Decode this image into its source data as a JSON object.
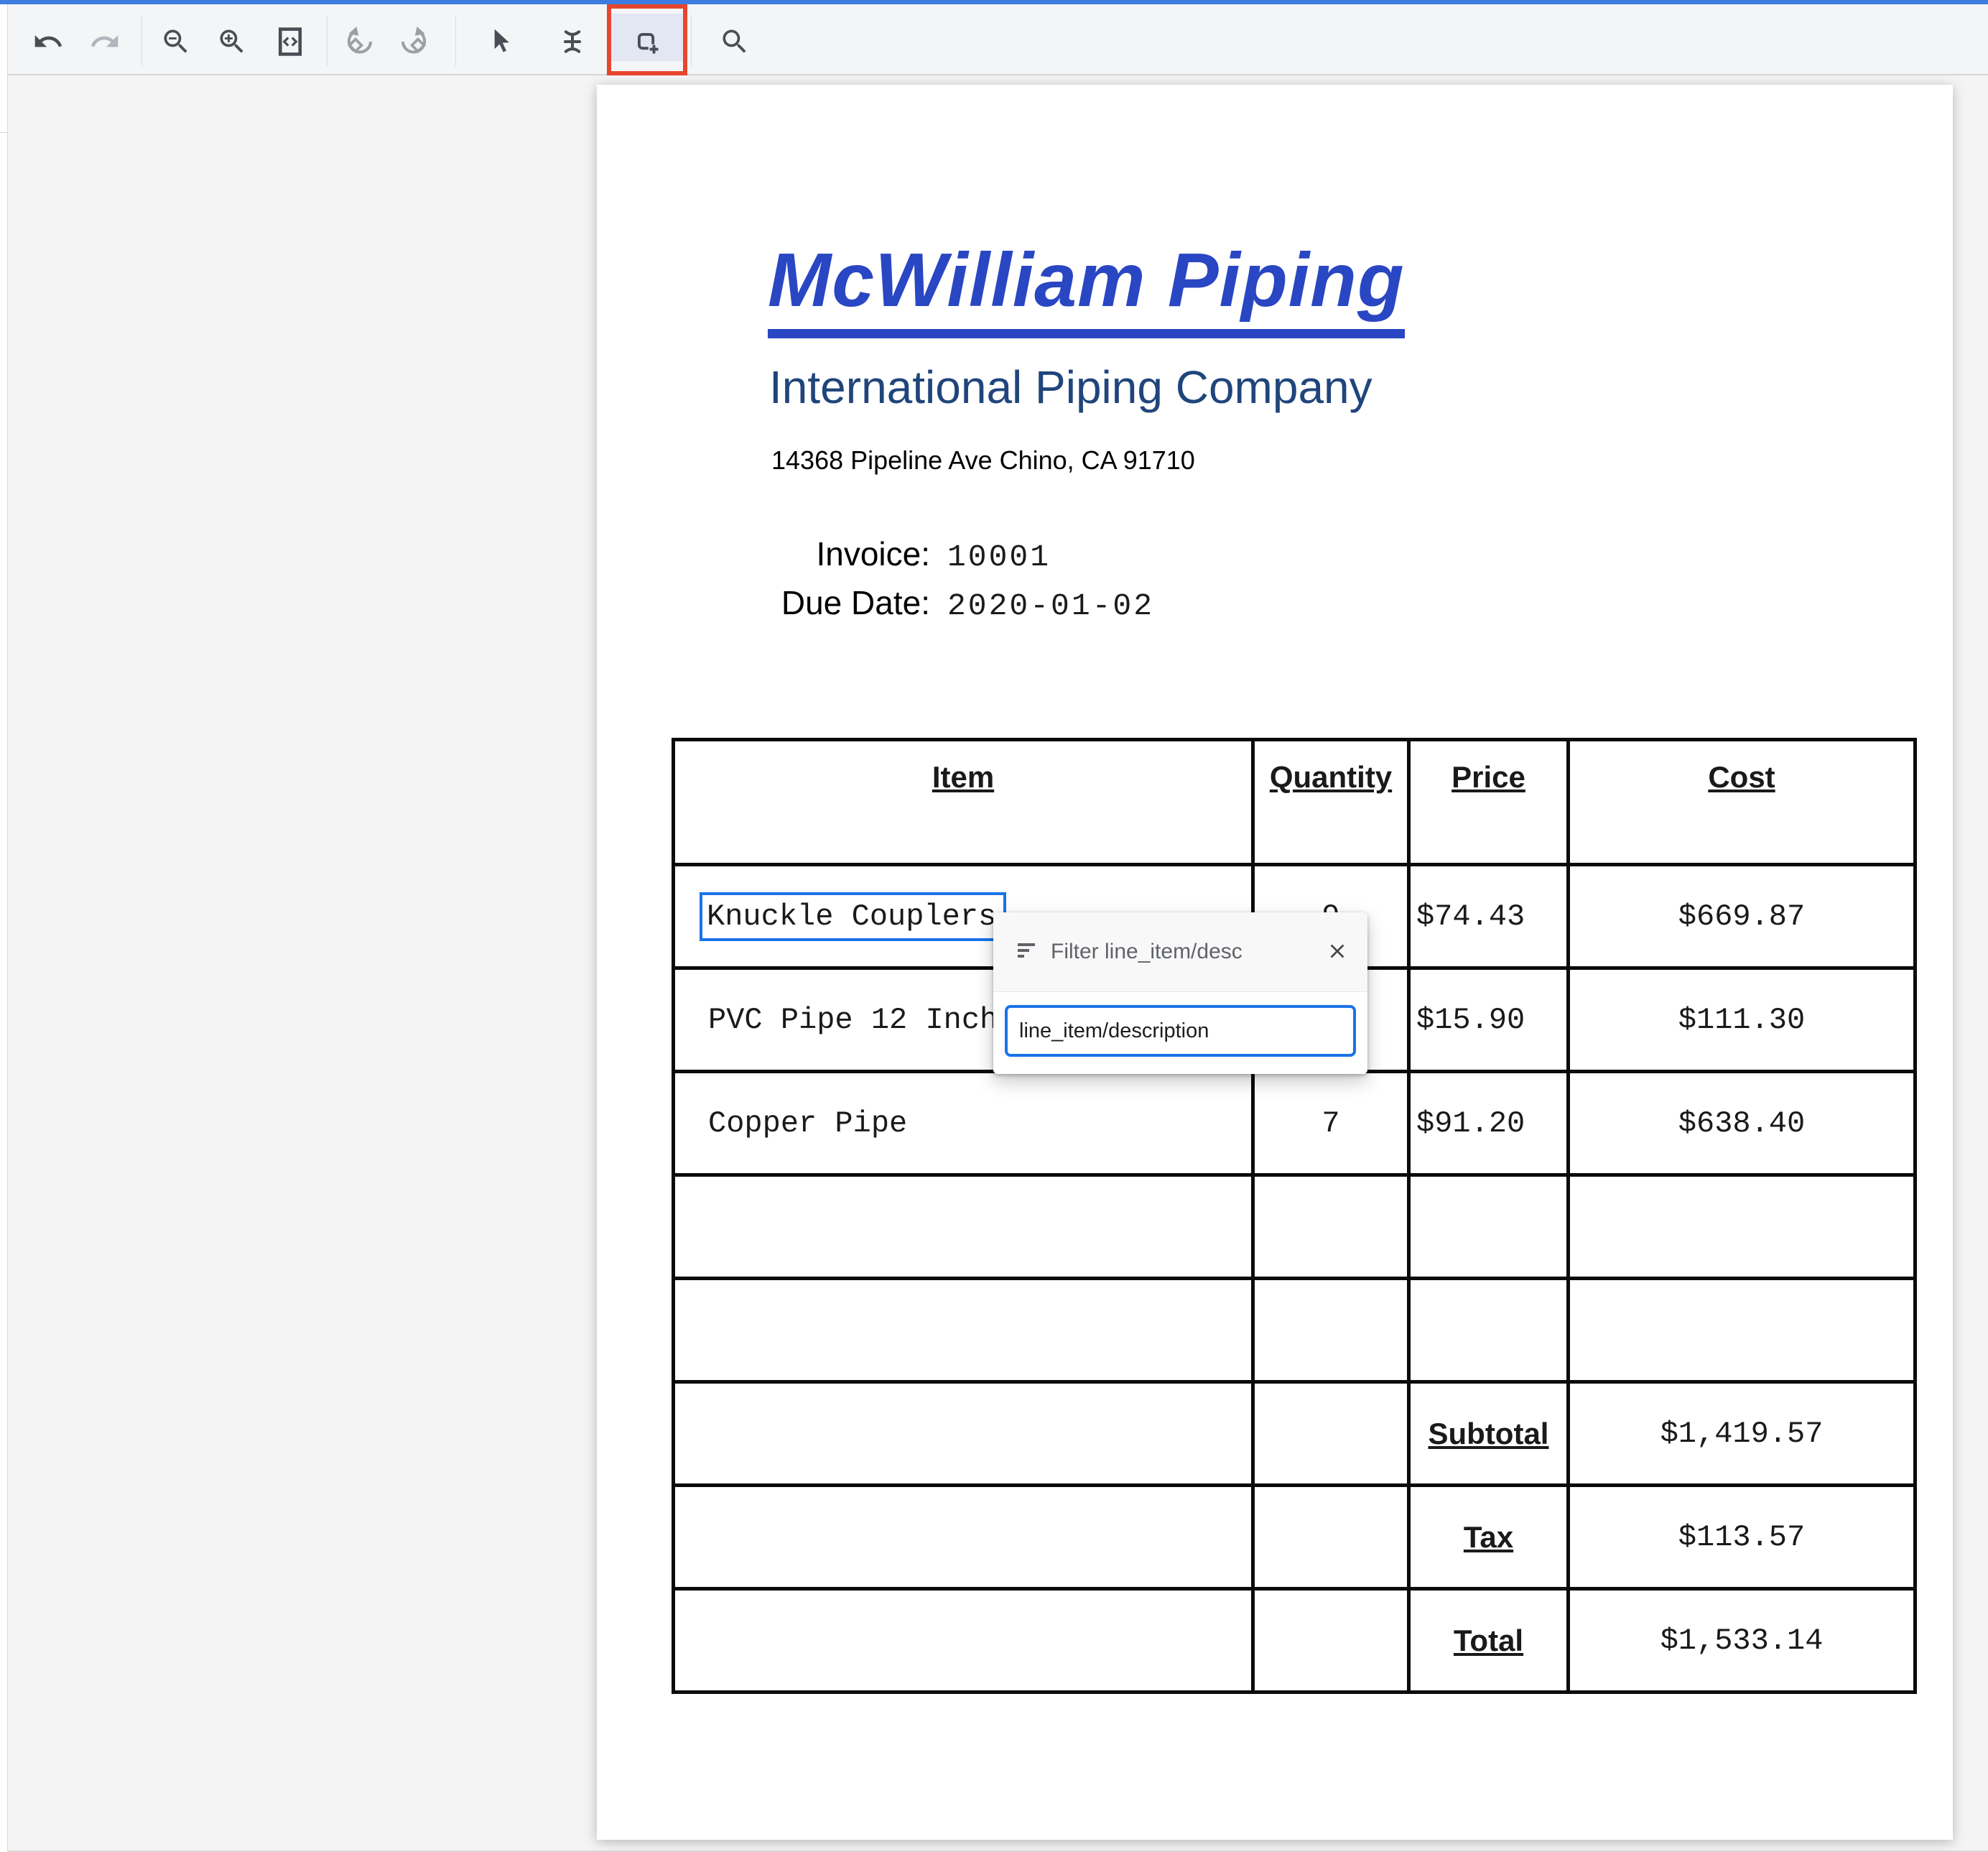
{
  "toolbar": {
    "icons": [
      "undo",
      "redo",
      "zoom-out",
      "zoom-in",
      "fit-to-page",
      "rotate-left",
      "rotate-right",
      "select-cursor",
      "text-select",
      "add-bounding-box",
      "search"
    ],
    "active_tool": "add-bounding-box"
  },
  "document": {
    "company_title": "McWilliam Piping",
    "company_subtitle": "International Piping Company",
    "company_address": "14368 Pipeline Ave Chino, CA 91710",
    "invoice": {
      "label": "Invoice:",
      "number": "10001",
      "due_label": "Due Date:",
      "due_date": "2020-01-02"
    },
    "table": {
      "headers": [
        "Item",
        "Quantity",
        "Price",
        "Cost"
      ],
      "rows": [
        [
          "Knuckle Couplers",
          "9",
          "$74.43",
          "$669.87"
        ],
        [
          "PVC Pipe 12 Inch",
          "",
          "$15.90",
          "$111.30"
        ],
        [
          "Copper Pipe",
          "7",
          "$91.20",
          "$638.40"
        ],
        [
          "",
          "",
          "",
          ""
        ],
        [
          "",
          "",
          "",
          ""
        ]
      ],
      "totals": [
        {
          "label": "Subtotal",
          "value": "$1,419.57"
        },
        {
          "label": "Tax",
          "value": "$113.57"
        },
        {
          "label": "Total",
          "value": "$1,533.14"
        }
      ]
    }
  },
  "annotation": {
    "selected_text": "Knuckle Couplers",
    "box_color": "#1a73e8",
    "tool_highlight_color": "#e5462e"
  },
  "popup": {
    "title": "Filter line_item/desc",
    "selected_option": "line_item/description"
  },
  "colors": {
    "topbar_blue": "#3f7ce0",
    "title_blue": "#2946c3",
    "subtitle_navy": "#20457c",
    "accent_blue": "#1a73e8",
    "annotation_red": "#e5462e"
  }
}
